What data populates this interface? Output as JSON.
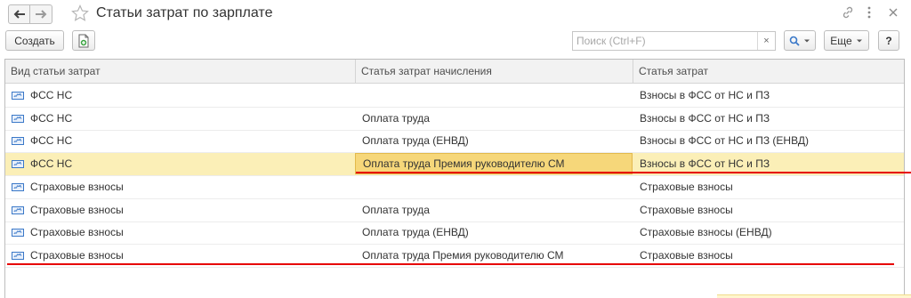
{
  "window": {
    "title": "Статьи затрат по зарплате"
  },
  "toolbar": {
    "create_label": "Создать",
    "search_placeholder": "Поиск (Ctrl+F)",
    "clear_glyph": "×",
    "more_label": "Еще",
    "help_label": "?"
  },
  "table": {
    "columns": [
      "Вид статьи затрат",
      "Статья затрат начисления",
      "Статья затрат"
    ],
    "rows": [
      {
        "type": "ФСС НС",
        "accrual": "",
        "cost": "Взносы в ФСС от НС и ПЗ"
      },
      {
        "type": "ФСС НС",
        "accrual": "Оплата труда",
        "cost": "Взносы в ФСС от НС и ПЗ"
      },
      {
        "type": "ФСС НС",
        "accrual": "Оплата труда (ЕНВД)",
        "cost": "Взносы в ФСС от НС и ПЗ (ЕНВД)"
      },
      {
        "type": "ФСС НС",
        "accrual": "Оплата труда Премия руководителю СМ",
        "cost": "Взносы в ФСС от НС и ПЗ"
      },
      {
        "type": "Страховые взносы",
        "accrual": "",
        "cost": "Страховые взносы"
      },
      {
        "type": "Страховые взносы",
        "accrual": "Оплата труда",
        "cost": "Страховые взносы"
      },
      {
        "type": "Страховые взносы",
        "accrual": "Оплата труда (ЕНВД)",
        "cost": "Страховые взносы (ЕНВД)"
      },
      {
        "type": "Страховые взносы",
        "accrual": "Оплата труда Премия руководителю СМ",
        "cost": "Страховые взносы"
      }
    ],
    "selected_row": 3
  },
  "colors": {
    "selected_row": "#fbefb7",
    "focused_cell": "#f6d77a",
    "annotation_line": "#e60000",
    "icon_blue": "#3a78c8"
  },
  "icons": {
    "back": "arrow-left-icon",
    "forward": "arrow-right-icon",
    "favorite": "star-icon",
    "link": "link-icon",
    "menu": "more-vertical-icon",
    "close": "close-icon",
    "copy": "copy-document-icon",
    "search": "search-icon",
    "row": "catalog-item-icon"
  }
}
